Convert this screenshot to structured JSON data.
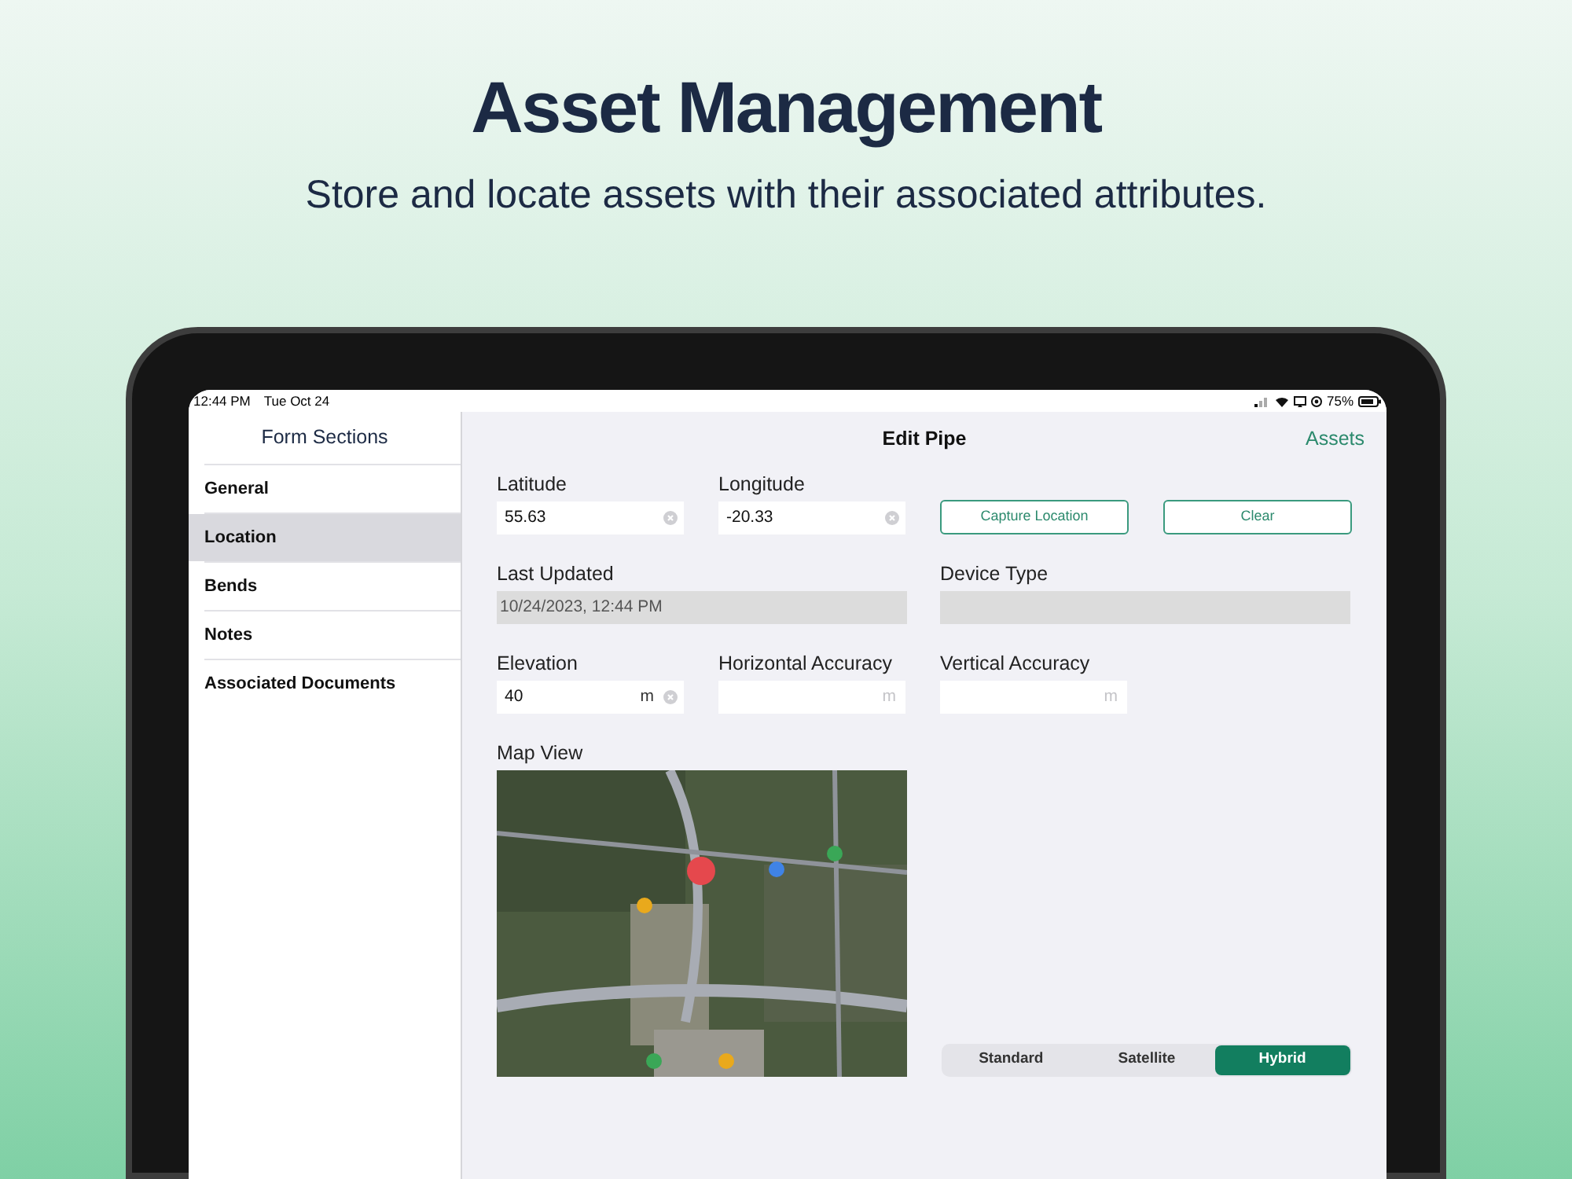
{
  "header": {
    "title": "Asset Management",
    "subtitle": "Store and locate assets with their associated attributes."
  },
  "status_bar": {
    "time": "12:44 PM",
    "date": "Tue Oct 24",
    "battery": "75%"
  },
  "sidebar": {
    "title": "Form Sections",
    "items": [
      {
        "label": "General",
        "selected": false
      },
      {
        "label": "Location",
        "selected": true
      },
      {
        "label": "Bends",
        "selected": false
      },
      {
        "label": "Notes",
        "selected": false
      },
      {
        "label": "Associated Documents",
        "selected": false
      }
    ]
  },
  "nav": {
    "title": "Edit Pipe",
    "action": "Assets"
  },
  "form": {
    "fields": [
      {
        "kind": "input",
        "label": "Latitude",
        "value": "55.63"
      },
      {
        "kind": "input",
        "label": "Longitude",
        "value": "-20.33"
      },
      {
        "kind": "button",
        "label": "Capture Location"
      },
      {
        "kind": "button",
        "label": "Clear"
      },
      {
        "kind": "readonly",
        "label": "Last Updated",
        "value": "10/24/2023, 12:44 PM"
      },
      {
        "kind": "readonly",
        "label": "Device Type"
      },
      {
        "kind": "input",
        "label": "Elevation",
        "value": "40",
        "unit": "m"
      },
      {
        "kind": "input",
        "label": "Horizontal Accuracy",
        "unit": "m"
      },
      {
        "kind": "input",
        "label": "Vertical Accuracy",
        "unit": "m"
      }
    ]
  },
  "map": {
    "label": "Map View",
    "kind": "picture"
  },
  "map_types": [
    {
      "label": "Standard",
      "selected": false
    },
    {
      "label": "Satellite",
      "selected": false
    },
    {
      "label": "Hybrid",
      "selected": true
    }
  ]
}
